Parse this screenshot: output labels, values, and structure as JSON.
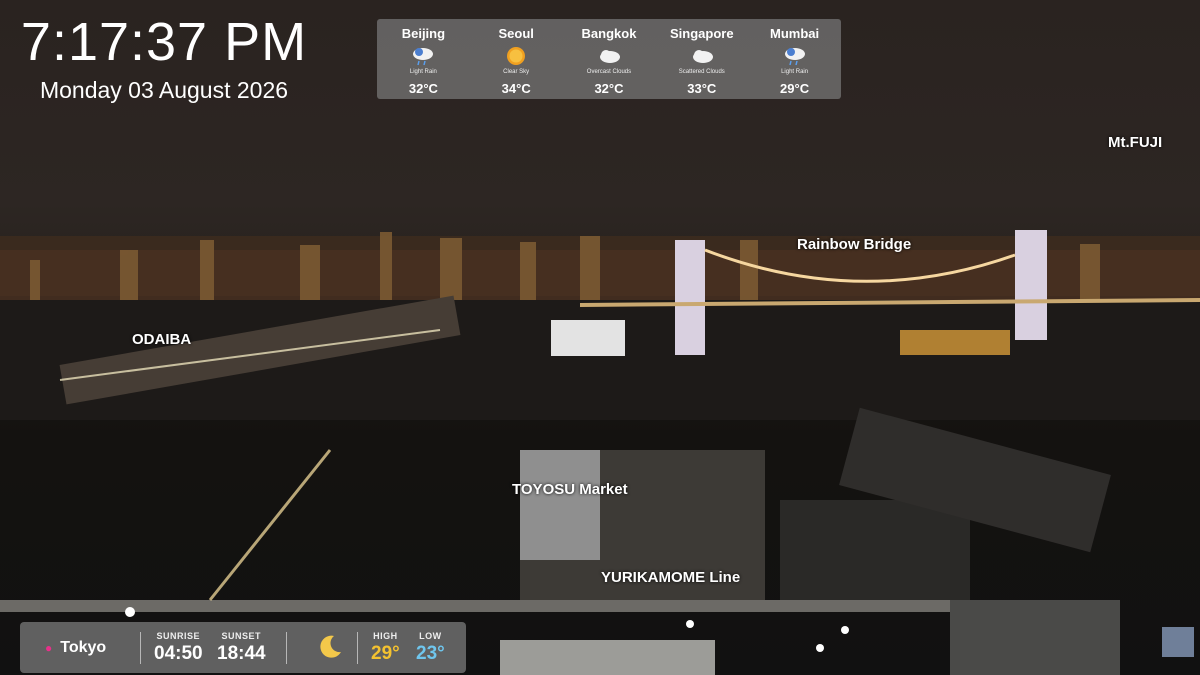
{
  "clock": {
    "time": "7:17:37 PM",
    "date": "Monday 03 August 2026"
  },
  "weather": [
    {
      "city": "Beijing",
      "icon": "rain-cloud-icon",
      "desc": "Light Rain",
      "temp": "32°C"
    },
    {
      "city": "Seoul",
      "icon": "sun-icon",
      "desc": "Clear Sky",
      "temp": "34°C"
    },
    {
      "city": "Bangkok",
      "icon": "cloud-icon",
      "desc": "Overcast Clouds",
      "temp": "32°C"
    },
    {
      "city": "Singapore",
      "icon": "cloud-icon",
      "desc": "Scattered Clouds",
      "temp": "33°C"
    },
    {
      "city": "Mumbai",
      "icon": "rain-cloud-icon",
      "desc": "Light Rain",
      "temp": "29°C"
    }
  ],
  "labels": {
    "mtfuji": "Mt.FUJI",
    "rainbow": "Rainbow Bridge",
    "odaiba": "ODAIBA",
    "toyosu": "TOYOSU Market",
    "yurikamome": "YURIKAMOME Line"
  },
  "bottom": {
    "location": "Tokyo",
    "location_icon": "map-pin-icon",
    "sunrise_label": "SUNRISE",
    "sunrise": "04:50",
    "sunset_label": "SUNSET",
    "sunset": "18:44",
    "moon_icon": "crescent-moon-icon",
    "high_label": "HIGH",
    "high": "29°",
    "low_label": "LOW",
    "low": "23°"
  },
  "colors": {
    "high": "#f4c230",
    "low": "#6fc6ee",
    "pin": "#e8308a",
    "panel": "#787878"
  }
}
